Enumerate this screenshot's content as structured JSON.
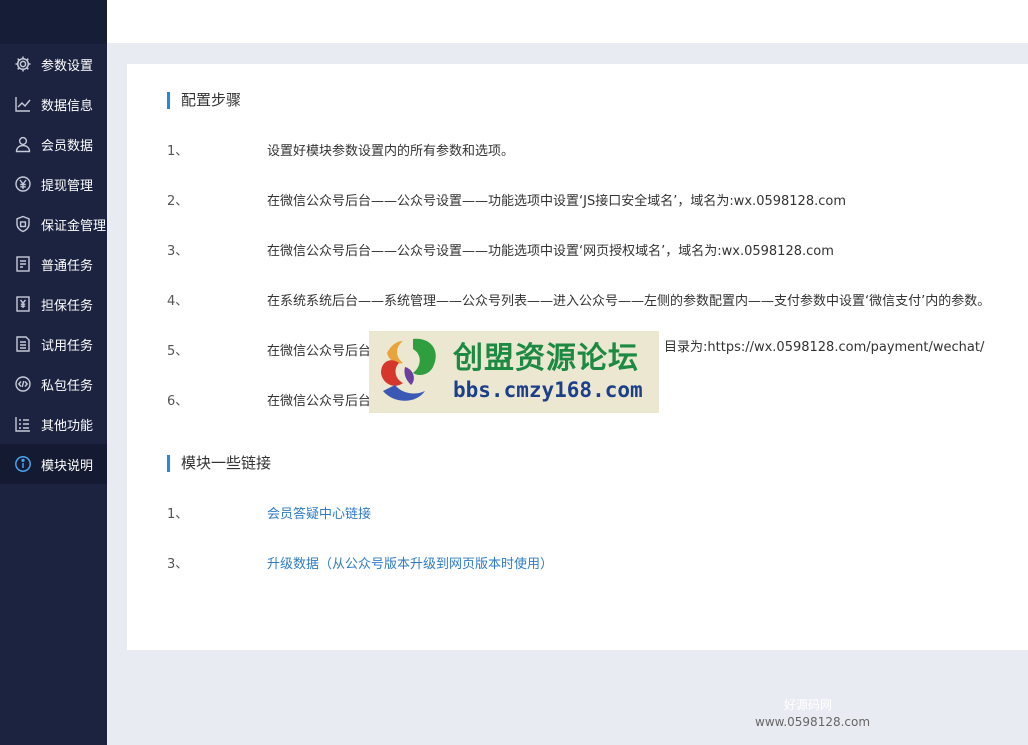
{
  "sidebar": {
    "items": [
      {
        "label": "参数设置",
        "icon": "gear-icon"
      },
      {
        "label": "数据信息",
        "icon": "line-chart-icon"
      },
      {
        "label": "会员数据",
        "icon": "user-icon"
      },
      {
        "label": "提现管理",
        "icon": "yen-circle-icon"
      },
      {
        "label": "保证金管理",
        "icon": "shield-icon"
      },
      {
        "label": "普通任务",
        "icon": "document-icon"
      },
      {
        "label": "担保任务",
        "icon": "yen-document-icon"
      },
      {
        "label": "试用任务",
        "icon": "list-document-icon"
      },
      {
        "label": "私包任务",
        "icon": "code-icon"
      },
      {
        "label": "其他功能",
        "icon": "list-icon"
      },
      {
        "label": "模块说明",
        "icon": "info-icon"
      }
    ],
    "active": "模块说明"
  },
  "main": {
    "config_title": "配置步骤",
    "steps": [
      {
        "num": "1、",
        "text": "设置好模块参数设置内的所有参数和选项。"
      },
      {
        "num": "2、",
        "text": "在微信公众号后台——公众号设置——功能选项中设置‘JS接口安全域名’，域名为:wx.0598128.com"
      },
      {
        "num": "3、",
        "text": "在微信公众号后台——公众号设置——功能选项中设置‘网页授权域名’，域名为:wx.0598128.com"
      },
      {
        "num": "4、",
        "text": "在系统系统后台——系统管理——公众号列表——进入公众号——左侧的参数配置内——支付参数中设置‘微信支付’内的参数。"
      },
      {
        "num": "5、",
        "text_a": "在微信公众号后台",
        "text_b": "目录为:https://wx.0598128.com/payment/wechat/"
      },
      {
        "num": "6、",
        "text": "在微信公众号后台"
      }
    ],
    "links_title": "模块一些链接",
    "links": [
      {
        "num": "1、",
        "label": "会员答疑中心链接"
      },
      {
        "num": "3、",
        "label": "升级数据（从公众号版本升级到网页版本时使用）"
      }
    ]
  },
  "watermark": {
    "cn": "创盟资源论坛",
    "url": "bbs.cmzy168.com"
  },
  "footer": {
    "line1": "好源码网",
    "line2": "www.0598128.com"
  }
}
